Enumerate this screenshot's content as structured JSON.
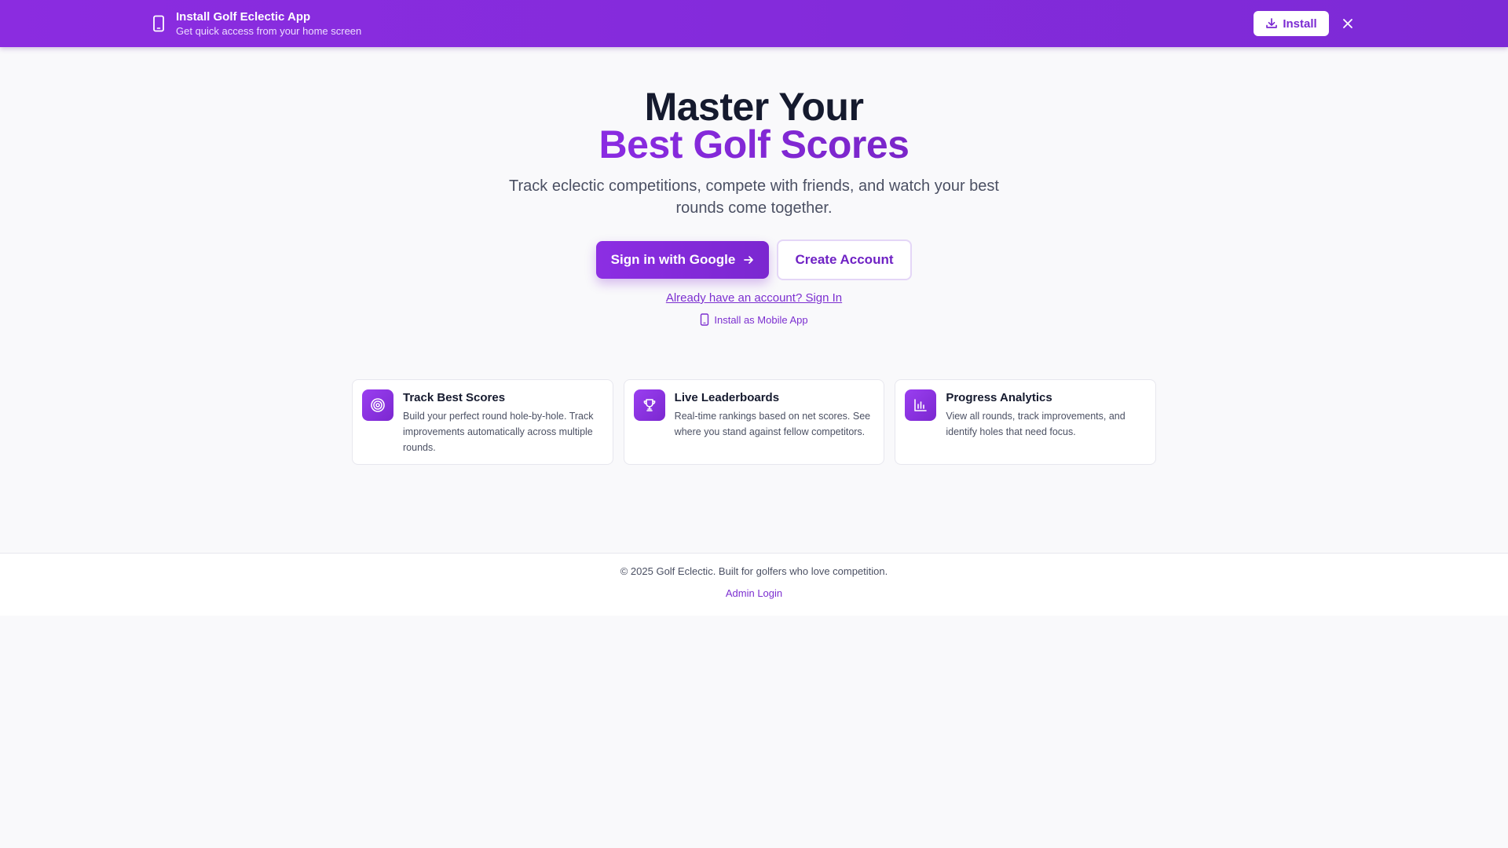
{
  "banner": {
    "title": "Install Golf Eclectic App",
    "subtitle": "Get quick access from your home screen",
    "install_label": "Install",
    "icons": {
      "phone": "smartphone-icon",
      "download": "download-icon",
      "close": "close-icon"
    }
  },
  "hero": {
    "title_line1": "Master Your",
    "title_line2": "Best Golf Scores",
    "subtitle": "Track eclectic competitions, compete with friends, and watch your best rounds come together.",
    "primary_cta": "Sign in with Google",
    "secondary_cta": "Create Account",
    "signin_link": "Already have an account? Sign In",
    "mobile_link": "Install as Mobile App"
  },
  "features": [
    {
      "icon": "target-icon",
      "title": "Track Best Scores",
      "description": "Build your perfect round hole-by-hole. Track improvements automatically across multiple rounds."
    },
    {
      "icon": "trophy-icon",
      "title": "Live Leaderboards",
      "description": "Real-time rankings based on net scores. See where you stand against fellow competitors."
    },
    {
      "icon": "bar-chart-icon",
      "title": "Progress Analytics",
      "description": "View all rounds, track improvements, and identify holes that need focus."
    }
  ],
  "footer": {
    "copyright": "© 2025 Golf Eclectic. Built for golfers who love competition.",
    "admin_link": "Admin Login"
  },
  "colors": {
    "brand": "#8a2be2",
    "brand_dark": "#7b27d0",
    "background": "#f9f9fb",
    "text": "#151a2e",
    "muted": "#4b5063"
  }
}
